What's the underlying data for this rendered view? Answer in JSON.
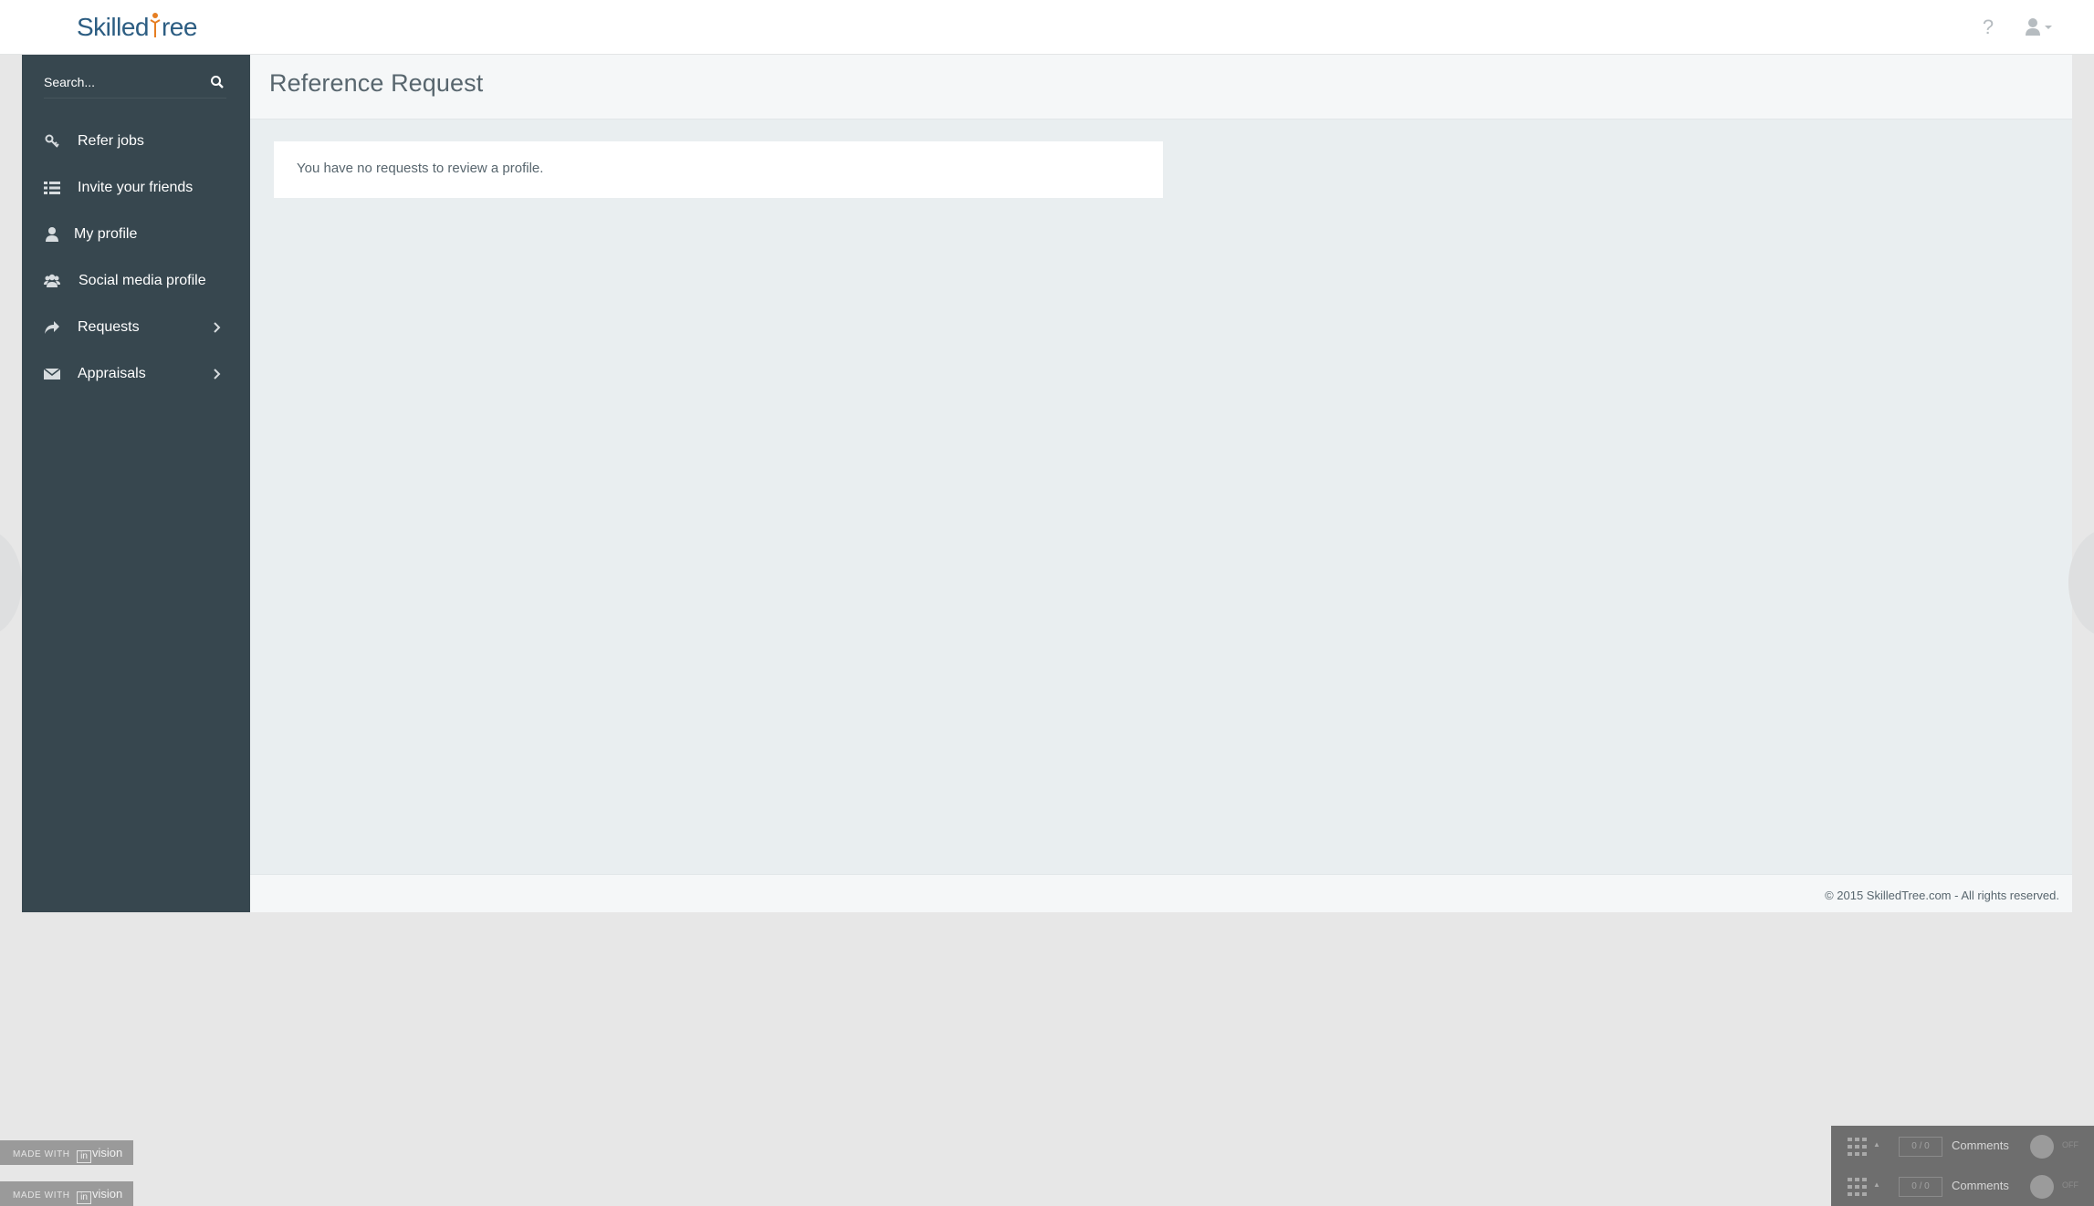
{
  "header": {
    "logo_text_a": "Skilled",
    "logo_text_b": "ree",
    "help_label": "?"
  },
  "sidebar": {
    "search_placeholder": "Search...",
    "items": [
      {
        "label": "Refer jobs",
        "icon": "key-icon"
      },
      {
        "label": "Invite your friends",
        "icon": "list-icon"
      },
      {
        "label": "My profile",
        "icon": "user-icon"
      },
      {
        "label": "Social media profile",
        "icon": "users-icon"
      },
      {
        "label": "Requests",
        "icon": "share-icon",
        "has_submenu": true
      },
      {
        "label": "Appraisals",
        "icon": "envelope-icon",
        "has_submenu": true
      }
    ]
  },
  "main": {
    "page_title": "Reference Request",
    "empty_message": "You have no requests to review a profile.",
    "footer_copyright": "© 2015 SkilledTree.com - All rights reserved."
  },
  "invision": {
    "badge_prefix": "MADE WITH",
    "badge_in": "in",
    "badge_brand": "vision"
  },
  "comment_bars": [
    {
      "count_a": "0",
      "count_b": "0",
      "label": "Comments",
      "toggle": "OFF"
    },
    {
      "count_a": "0",
      "count_b": "0",
      "label": "Comments",
      "toggle": "OFF"
    }
  ],
  "colors": {
    "sidebar_bg": "#37474f",
    "main_bg": "#e9eef0",
    "brand_blue": "#2c5d82",
    "brand_orange": "#e67e22"
  }
}
